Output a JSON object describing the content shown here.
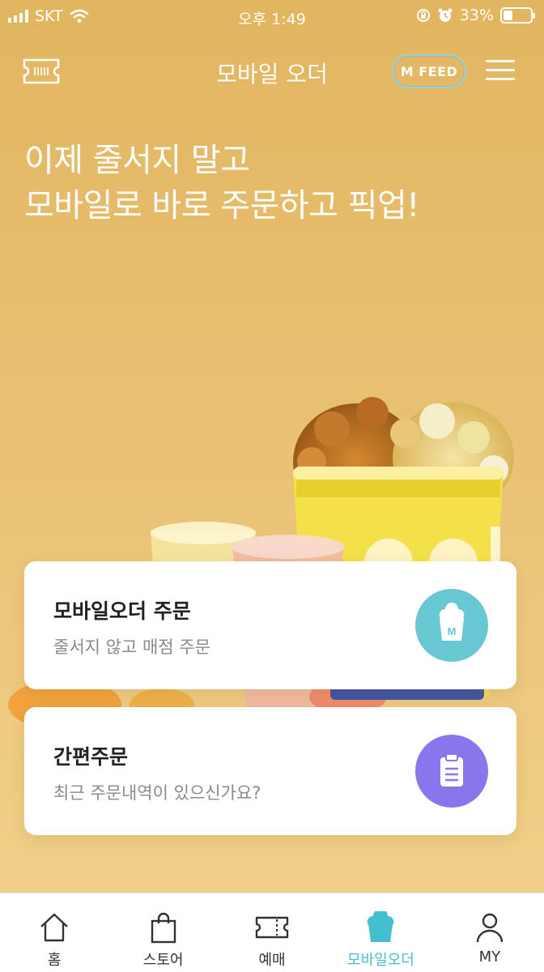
{
  "status_bar": {
    "carrier": "SKT",
    "time": "오후 1:49",
    "battery": "33%",
    "battery_level": 0.33
  },
  "header": {
    "title": "모바일 오더",
    "feed_label": "M FEED",
    "ticket_icon": "ticket-icon",
    "menu_icon": "hamburger-menu-icon"
  },
  "hero": {
    "line1": "이제 줄서지 말고",
    "line2": "모바일로 바로 주문하고 픽업!"
  },
  "cards": [
    {
      "title": "모바일오더 주문",
      "subtitle": "줄서지 않고 매점 주문",
      "icon": "popcorn-m-icon",
      "icon_color": "#67c8d4"
    },
    {
      "title": "간편주문",
      "subtitle": "최근 주문내역이 있으신가요?",
      "icon": "clipboard-icon",
      "icon_color": "#8a76ec"
    }
  ],
  "tabbar": {
    "active_color": "#43bfcf",
    "items": [
      {
        "label": "홈",
        "icon": "home-icon"
      },
      {
        "label": "스토어",
        "icon": "shopping-bag-icon"
      },
      {
        "label": "예매",
        "icon": "ticket-icon"
      },
      {
        "label": "모바일오더",
        "icon": "popcorn-icon"
      },
      {
        "label": "MY",
        "icon": "person-icon"
      }
    ]
  }
}
